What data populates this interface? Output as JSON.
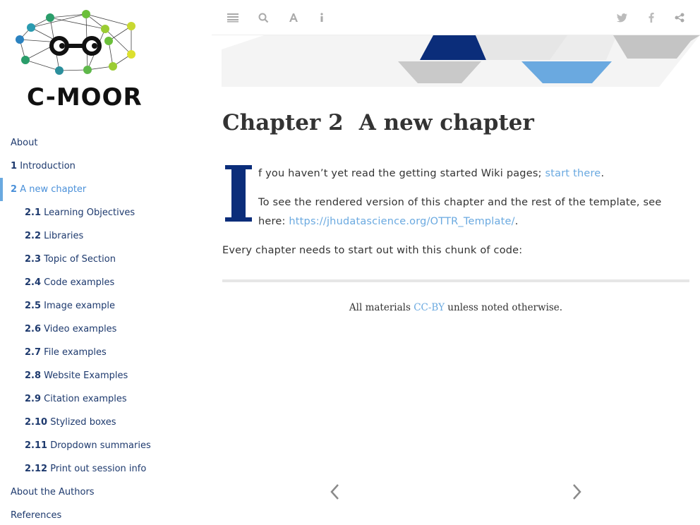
{
  "logo": {
    "text": "C-MOOR"
  },
  "toc": {
    "items": [
      {
        "num": "",
        "label": "About",
        "level": 1,
        "active": false
      },
      {
        "num": "1",
        "label": "Introduction",
        "level": 1,
        "active": false
      },
      {
        "num": "2",
        "label": "A new chapter",
        "level": 1,
        "active": true
      },
      {
        "num": "2.1",
        "label": "Learning Objectives",
        "level": 2,
        "active": false
      },
      {
        "num": "2.2",
        "label": "Libraries",
        "level": 2,
        "active": false
      },
      {
        "num": "2.3",
        "label": "Topic of Section",
        "level": 2,
        "active": false
      },
      {
        "num": "2.4",
        "label": "Code examples",
        "level": 2,
        "active": false
      },
      {
        "num": "2.5",
        "label": "Image example",
        "level": 2,
        "active": false
      },
      {
        "num": "2.6",
        "label": "Video examples",
        "level": 2,
        "active": false
      },
      {
        "num": "2.7",
        "label": "File examples",
        "level": 2,
        "active": false
      },
      {
        "num": "2.8",
        "label": "Website Examples",
        "level": 2,
        "active": false
      },
      {
        "num": "2.9",
        "label": "Citation examples",
        "level": 2,
        "active": false
      },
      {
        "num": "2.10",
        "label": "Stylized boxes",
        "level": 2,
        "active": false
      },
      {
        "num": "2.11",
        "label": "Dropdown summaries",
        "level": 2,
        "active": false
      },
      {
        "num": "2.12",
        "label": "Print out session info",
        "level": 2,
        "active": false
      },
      {
        "num": "",
        "label": "About the Authors",
        "level": 1,
        "active": false
      },
      {
        "num": "",
        "label": "References",
        "level": 1,
        "active": false
      }
    ]
  },
  "toolbar": {
    "left_icons": [
      "toc-toggle-icon",
      "search-icon",
      "font-settings-icon",
      "info-icon"
    ],
    "right_icons": [
      "twitter-icon",
      "facebook-icon",
      "share-icon"
    ]
  },
  "chapter": {
    "number": "Chapter 2",
    "title": "A new chapter",
    "dropcap_letter": "I",
    "para1_text": "f you haven’t yet read the getting started Wiki pages; ",
    "para1_link": "start there",
    "para1_end": ".",
    "para2_text": "To see the rendered version of this chapter and the rest of the template, see here: ",
    "para2_link": "https://jhudatascience.org/OTTR_Template/",
    "para2_end": ".",
    "para3_text": "Every chapter needs to start out with this chunk of code:"
  },
  "footer": {
    "prefix": "All materials ",
    "license": "CC-BY",
    "suffix": " unless noted otherwise."
  },
  "nav": {
    "prev_icon": "chevron-left-icon",
    "next_icon": "chevron-right-icon"
  },
  "colors": {
    "accent": "#6aa9e0",
    "navy": "#0b2d7a",
    "toc_text": "#1e3a6e",
    "icon_gray": "#b0b0b0"
  }
}
